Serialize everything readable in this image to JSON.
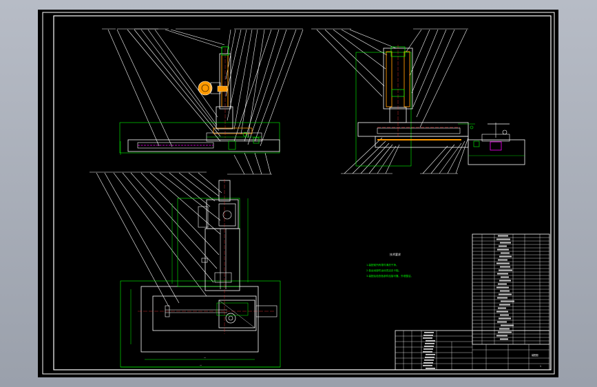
{
  "drawing": {
    "background_color": "#000000",
    "viewport_bg_color": "#a7adb7",
    "line_color_main": "#ffffff",
    "line_color_dim": "#00ff00",
    "line_color_part": "#ff9900",
    "line_color_hidden": "#ff00ff",
    "line_color_center": "#ff3333",
    "line_color_detail": "#00ffff"
  },
  "notes": {
    "title": "技术要求",
    "lines": [
      "1.装配前所有零件清洗干净。",
      "2.各运动部件运动灵活无卡阻。",
      "3.装配后检查各部件连接可靠，外观整洁。"
    ]
  },
  "title_block": {
    "drawing_name": "装配图",
    "scale": "1:5",
    "sheet": "1"
  }
}
